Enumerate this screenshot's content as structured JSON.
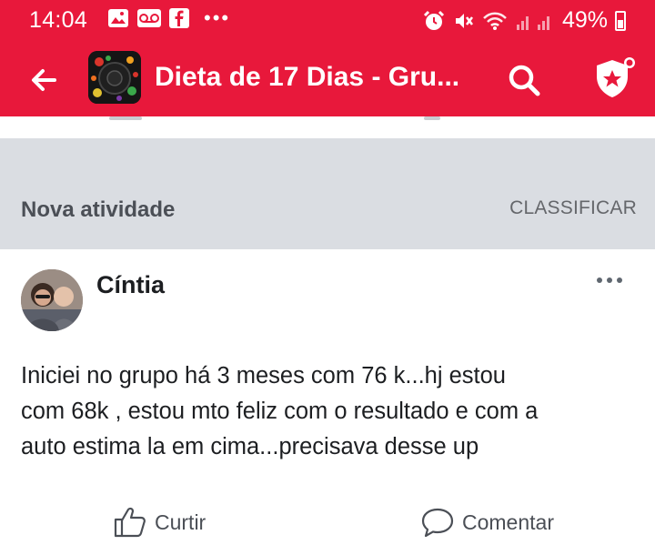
{
  "colors": {
    "accent": "#e8183b",
    "band": "#dadde2"
  },
  "status_bar": {
    "time": "14:04",
    "battery": "49%",
    "left_icons": [
      "gallery-icon",
      "voicemail-icon",
      "facebook-icon"
    ],
    "right_icons": [
      "alarm-icon",
      "mute-icon",
      "wifi-icon",
      "signal-icon",
      "battery-icon"
    ]
  },
  "app_bar": {
    "title": "Dieta de 17 Dias - Gru...",
    "icons": [
      "back-arrow-icon",
      "search-icon",
      "shield-icon"
    ]
  },
  "feed_header": {
    "section_label": "Nova atividade",
    "sort_label": "CLASSIFICAR"
  },
  "post": {
    "author": "Cíntia",
    "lines": [
      "Iniciei no grupo há 3 meses com 76 k...hj estou",
      "com 68k , estou mto feliz com o resultado e com a",
      "auto estima la em cima...precisava desse up"
    ],
    "actions": {
      "like": "Curtir",
      "comment": "Comentar"
    }
  }
}
